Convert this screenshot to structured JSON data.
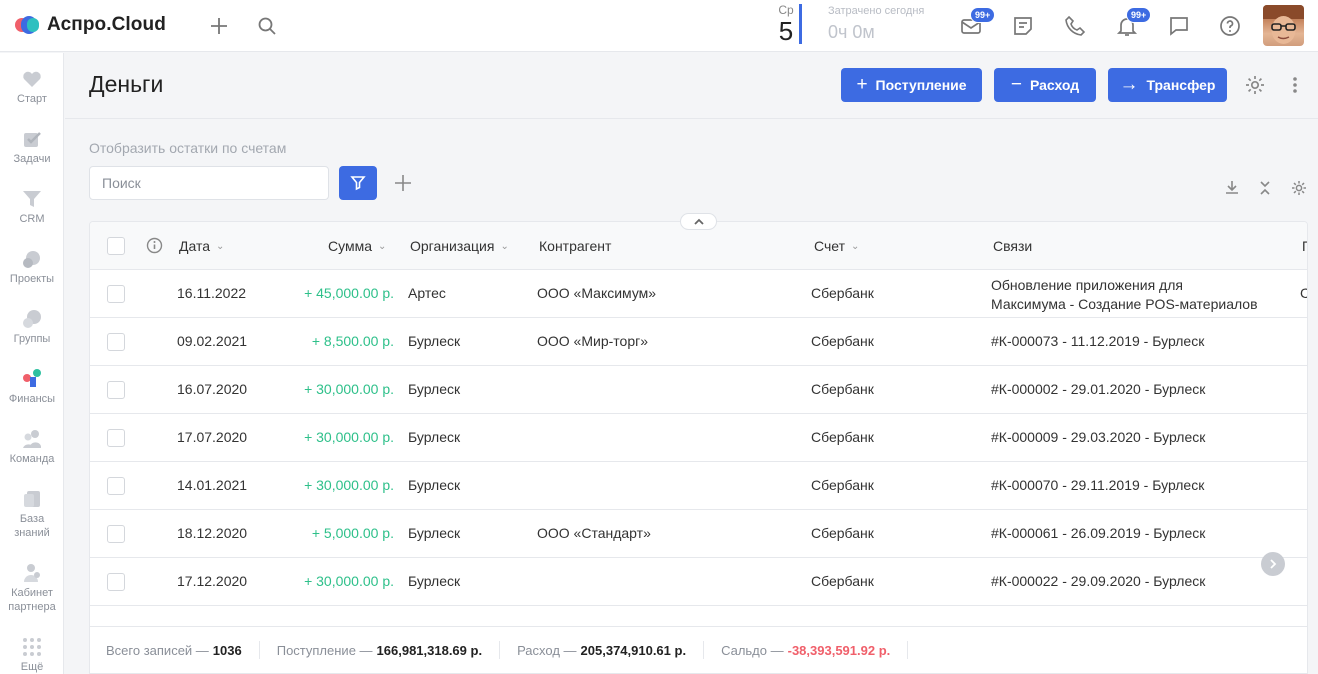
{
  "app": {
    "logo_text": "Аспро.Cloud",
    "accent_color": "#3d6be2"
  },
  "topbar": {
    "weekday": "Ср",
    "day": "5",
    "spent_label": "Затрачено сегодня",
    "spent_value": "0ч 0м",
    "mail_badge": "99+",
    "notif_badge": "99+",
    "icons": [
      "plus-icon",
      "search-icon",
      "mail-icon",
      "notes-icon",
      "phone-icon",
      "bell-icon",
      "chat-icon",
      "help-icon"
    ]
  },
  "sidebar": {
    "items": [
      {
        "label": "Старт",
        "icon": "heart-icon"
      },
      {
        "label": "Задачи",
        "icon": "check-icon"
      },
      {
        "label": "CRM",
        "icon": "funnel-icon"
      },
      {
        "label": "Проекты",
        "icon": "projects-icon"
      },
      {
        "label": "Группы",
        "icon": "groups-icon"
      },
      {
        "label": "Финансы",
        "icon": "finance-icon"
      },
      {
        "label": "Команда",
        "icon": "team-icon"
      },
      {
        "label": "База\nзнаний",
        "icon": "knowledge-icon"
      },
      {
        "label": "Кабинет\nпартнера",
        "icon": "partner-icon"
      },
      {
        "label": "Ещё",
        "icon": "grid-icon"
      }
    ]
  },
  "header": {
    "title": "Деньги",
    "income_label": "Поступление",
    "expense_label": "Расход",
    "transfer_label": "Трансфер"
  },
  "filters": {
    "show_balances": "Отобразить остатки по счетам",
    "search_placeholder": "Поиск"
  },
  "table": {
    "columns": {
      "date": "Дата",
      "amount": "Сумма",
      "org": "Организация",
      "counterparty": "Контрагент",
      "account": "Счет",
      "links": "Связи",
      "next": "П"
    },
    "rows": [
      {
        "date": "16.11.2022",
        "amount": "+ 45,000.00 р.",
        "org": "Артес",
        "counterparty": "ООО «Максимум»",
        "account": "Сбербанк",
        "links": "Обновление приложения для",
        "links2": "Максимума - Создание POS-материалов",
        "next": "С"
      },
      {
        "date": "09.02.2021",
        "amount": "+ 8,500.00 р.",
        "org": "Бурлеск",
        "counterparty": "ООО «Мир-торг»",
        "account": "Сбербанк",
        "links": "#К-000073 - 11.12.2019 - Бурлеск"
      },
      {
        "date": "16.07.2020",
        "amount": "+ 30,000.00 р.",
        "org": "Бурлеск",
        "counterparty": "",
        "account": "Сбербанк",
        "links": "#К-000002 - 29.01.2020 - Бурлеск"
      },
      {
        "date": "17.07.2020",
        "amount": "+ 30,000.00 р.",
        "org": "Бурлеск",
        "counterparty": "",
        "account": "Сбербанк",
        "links": "#К-000009 - 29.03.2020 - Бурлеск"
      },
      {
        "date": "14.01.2021",
        "amount": "+ 30,000.00 р.",
        "org": "Бурлеск",
        "counterparty": "",
        "account": "Сбербанк",
        "links": "#К-000070 - 29.11.2019 - Бурлеск"
      },
      {
        "date": "18.12.2020",
        "amount": "+ 5,000.00 р.",
        "org": "Бурлеск",
        "counterparty": "ООО «Стандарт»",
        "account": "Сбербанк",
        "links": "#К-000061 - 26.09.2019 - Бурлеск"
      },
      {
        "date": "17.12.2020",
        "amount": "+ 30,000.00 р.",
        "org": "Бурлеск",
        "counterparty": "",
        "account": "Сбербанк",
        "links": "#К-000022 - 29.09.2020 - Бурлеск"
      }
    ]
  },
  "footer": {
    "total_label": "Всего записей —",
    "total_value": "1036",
    "income_label": "Поступление —",
    "income_value": "166,981,318.69 р.",
    "expense_label": "Расход —",
    "expense_value": "205,374,910.61 р.",
    "balance_label": "Сальдо —",
    "balance_value": "-38,393,591.92 р."
  }
}
